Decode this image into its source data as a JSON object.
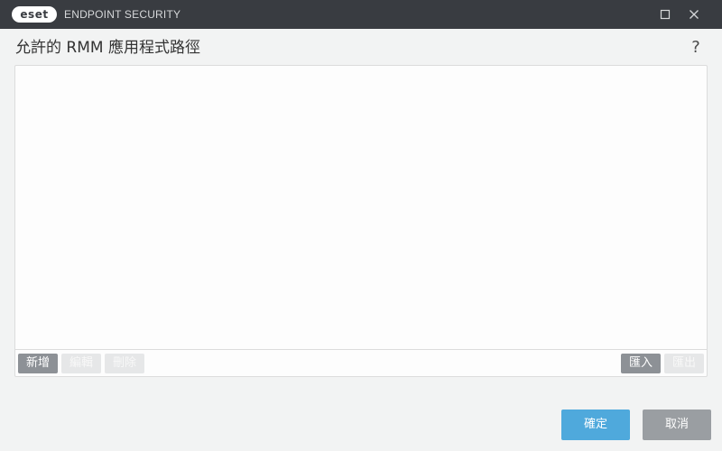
{
  "window": {
    "logo_text": "eset",
    "app_name": "ENDPOINT SECURITY",
    "maximize_icon": "maximize-icon",
    "close_icon": "close-icon"
  },
  "dialog": {
    "title": "允許的 RMM 應用程式路徑",
    "help_label": "?"
  },
  "list": {
    "items": [],
    "toolbar": {
      "add_label": "新增",
      "edit_label": "編輯",
      "delete_label": "刪除",
      "import_label": "匯入",
      "export_label": "匯出"
    }
  },
  "footer": {
    "ok_label": "確定",
    "cancel_label": "取消"
  },
  "colors": {
    "titlebar": "#393c41",
    "primary_button": "#4fa9dc",
    "secondary_button": "#9a9ea2",
    "toolbar_button_active": "#8d9196",
    "toolbar_button_disabled": "#e6e7e8"
  }
}
